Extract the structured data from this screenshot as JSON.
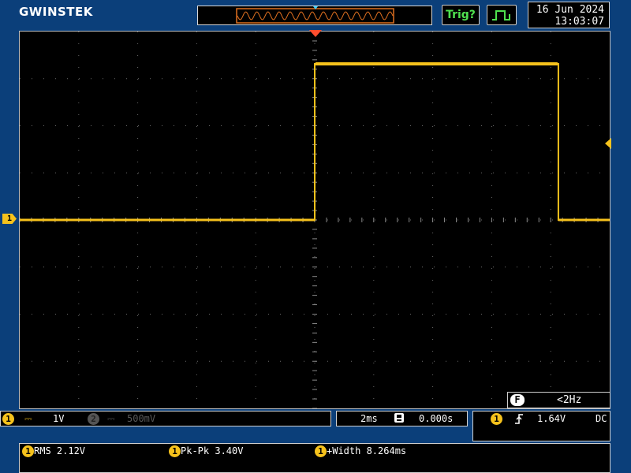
{
  "header": {
    "brand": "GWINSTEK",
    "trigger_status": "Trig?",
    "date": "16 Jun 2024",
    "time": "13:03:07"
  },
  "icons": {
    "acquire": "pulse-waveform-icon",
    "trigger_position": "trigger-position-marker-icon",
    "channel_marker": "ch1-ground-marker-icon",
    "trigger_level": "trigger-level-arrow-icon",
    "coupling": "dc-coupling-icon",
    "memory": "memory-lock-icon",
    "edge": "rising-edge-icon"
  },
  "colors": {
    "background": "#0b3f7a",
    "screen": "#000000",
    "ch1": "#f6c21c",
    "trigger_marker": "#ff4d2e",
    "trig_status": "#4fe04f"
  },
  "waveform": {
    "high_fraction": 0.333,
    "low_fraction": 0.5,
    "rise_fraction": 0.5,
    "fall_fraction": 0.913
  },
  "screen": {
    "ch1_badge": "1",
    "freq_badge": "F",
    "frequency": "<2Hz"
  },
  "status_bar": {
    "ch1_num": "1",
    "ch1_scale": "1V",
    "ch2_num": "2",
    "ch2_scale": "500mV",
    "timebase": "2ms",
    "time_offset": "0.000s",
    "trigger_source": "1",
    "trigger_level": "1.64V",
    "trigger_coupling": "DC"
  },
  "measurements": [
    {
      "source": "1",
      "label": "RMS 2.12V"
    },
    {
      "source": "1",
      "label": "Pk-Pk 3.40V"
    },
    {
      "source": "1",
      "label": "+Width 8.264ms"
    }
  ]
}
